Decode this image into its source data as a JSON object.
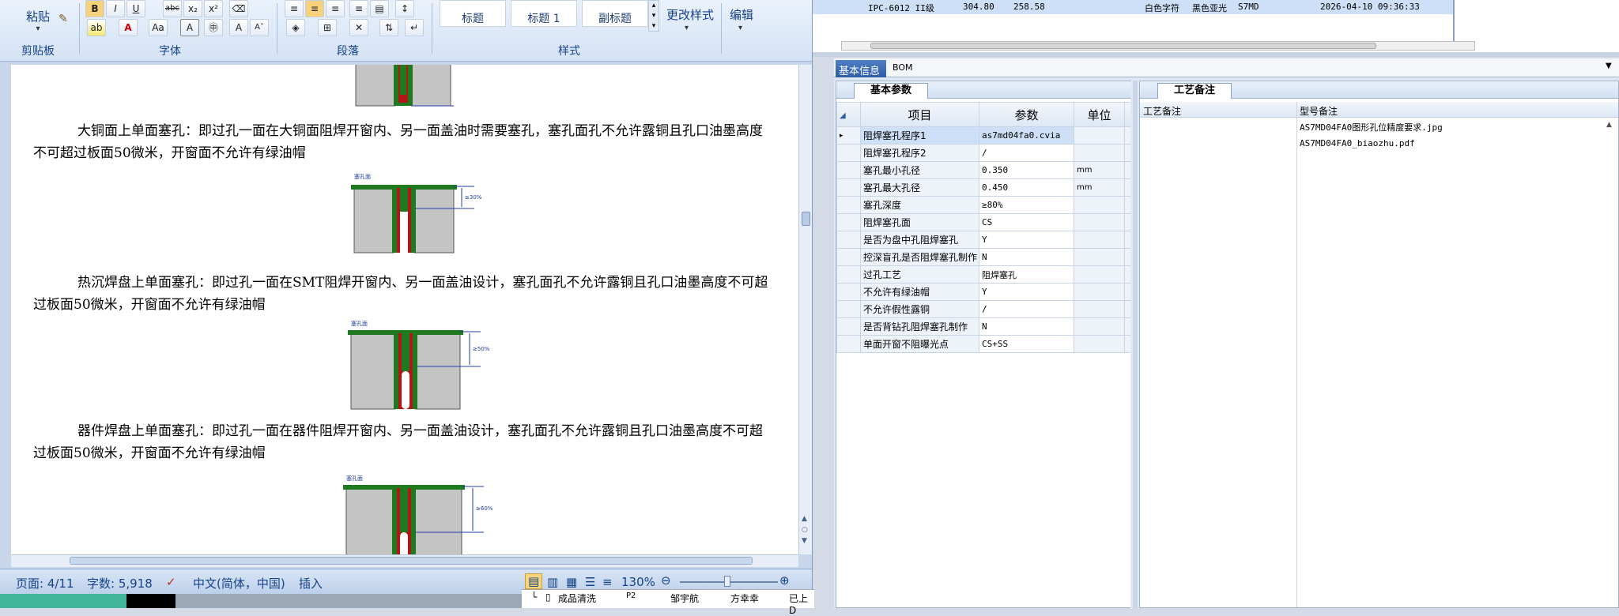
{
  "ribbon": {
    "paste_label": "粘贴",
    "groups": [
      "剪贴板",
      "字体",
      "段落",
      "样式"
    ],
    "font_buttons": [
      "B",
      "I",
      "U",
      "abc",
      "x₂",
      "x²",
      "A",
      "Aa",
      "A",
      "A"
    ],
    "styles": [
      "标题",
      "标题 1",
      "副标题"
    ],
    "change_styles_label": "更改样式",
    "edit_label": "编辑"
  },
  "document": {
    "paragraphs": [
      "大铜面上单面塞孔：即过孔一面在大铜面阻焊开窗内、另一面盖油时需要塞孔，塞孔面孔不允许露铜且孔口油墨高度不可超过板面50微米，开窗面不允许有绿油帽",
      "热沉焊盘上单面塞孔：即过孔一面在SMT阻焊开窗内、另一面盖油设计，塞孔面孔不允许露铜且孔口油墨高度不可超过板面50微米，开窗面不允许有绿油帽",
      "器件焊盘上单面塞孔：即过孔一面在器件阻焊开窗内、另一面盖油设计，塞孔面孔不允许露铜且孔口油墨高度不可超过板面50微米，开窗面不允许有绿油帽"
    ],
    "figure_labels": [
      "塞孔面",
      "≥30%",
      "塞孔面",
      "≥50%",
      "塞孔面",
      "≥60%"
    ]
  },
  "status_bar": {
    "page": "页面: 4/11",
    "words": "字数: 5,918",
    "language": "中文(简体，中国)",
    "mode": "插入",
    "zoom": "130%"
  },
  "top_row": {
    "cells": [
      "IPC-6012 II级",
      "304.80",
      "258.58",
      "白色字符",
      "黑色亚光",
      "S7MD",
      "2026-04-10 09:36:33"
    ]
  },
  "right_panel": {
    "tabs": [
      "基本信息",
      "BOM"
    ],
    "param_tab": "基本参数",
    "remark_tab": "工艺备注",
    "columns": [
      "项目",
      "参数",
      "单位"
    ],
    "rows": [
      {
        "item": "阻焊塞孔程序1",
        "param": "as7md04fa0.cvia",
        "unit": ""
      },
      {
        "item": "阻焊塞孔程序2",
        "param": "/",
        "unit": ""
      },
      {
        "item": "塞孔最小孔径",
        "param": "0.350",
        "unit": "mm"
      },
      {
        "item": "塞孔最大孔径",
        "param": "0.450",
        "unit": "mm"
      },
      {
        "item": "塞孔深度",
        "param": "≥80%",
        "unit": ""
      },
      {
        "item": "阻焊塞孔面",
        "param": "CS",
        "unit": ""
      },
      {
        "item": "是否为盘中孔阻焊塞孔",
        "param": "Y",
        "unit": ""
      },
      {
        "item": "控深盲孔是否阻焊塞孔制作",
        "param": "N",
        "unit": ""
      },
      {
        "item": "过孔工艺",
        "param": "阻焊塞孔",
        "unit": ""
      },
      {
        "item": "不允许有绿油帽",
        "param": "Y",
        "unit": ""
      },
      {
        "item": "不允许假性露铜",
        "param": "/",
        "unit": ""
      },
      {
        "item": "是否背钻孔阻焊塞孔制作",
        "param": "N",
        "unit": ""
      },
      {
        "item": "单面开窗不阻曝光点",
        "param": "CS+SS",
        "unit": ""
      }
    ],
    "remark_columns": [
      "工艺备注",
      "型号备注"
    ],
    "remark_files": [
      "AS7MD04FA0图形孔位精度要求.jpg",
      "AS7MD04FA0_biaozhu.pdf"
    ]
  },
  "bottom_strip": {
    "cells": [
      "成品清洗",
      "P2",
      "邹宇航",
      "方幸幸",
      "已上D"
    ]
  },
  "colors": {
    "ribbon_text": "#15428b",
    "selected_row": "#cde0f7",
    "tab_blue": "#2d5ea8",
    "copper_green": "#1f7a1f",
    "hole_red": "#b01818"
  }
}
